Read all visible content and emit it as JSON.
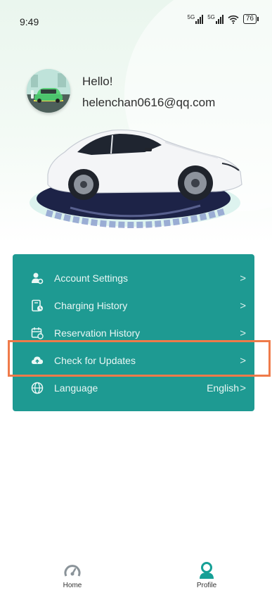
{
  "status_bar": {
    "time": "9:49",
    "signal_label_1": "5G",
    "signal_label_2": "5G",
    "battery": "76"
  },
  "profile": {
    "greeting": "Hello!",
    "email": "helenchan0616@qq.com"
  },
  "menu": {
    "items": [
      {
        "label": "Account Settings",
        "icon": "account-settings-icon",
        "chevron": ">"
      },
      {
        "label": "Charging History",
        "icon": "charging-history-icon",
        "chevron": ">"
      },
      {
        "label": "Reservation History",
        "icon": "reservation-history-icon",
        "chevron": ">"
      },
      {
        "label": "Check for Updates",
        "icon": "cloud-upload-icon",
        "chevron": ">"
      },
      {
        "label": "Language",
        "icon": "globe-icon",
        "value": "English",
        "chevron": ">"
      }
    ]
  },
  "tabbar": {
    "home_label": "Home",
    "profile_label": "Profile"
  },
  "colors": {
    "accent": "#1e9a92",
    "highlight": "#ef7b4a",
    "profile_tab": "#16a096"
  }
}
